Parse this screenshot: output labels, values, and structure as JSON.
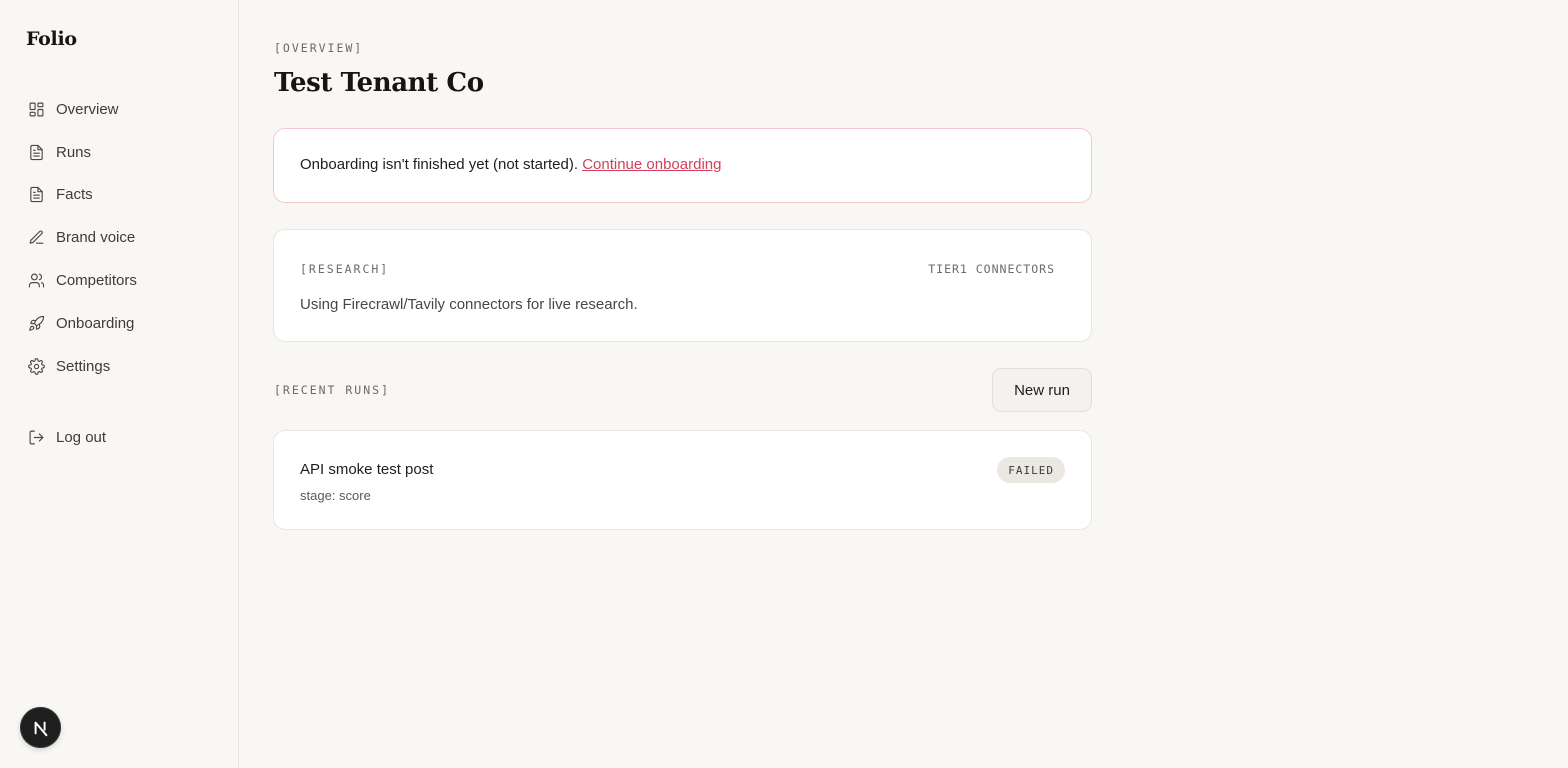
{
  "app": {
    "brand": "Folio"
  },
  "sidebar": {
    "items": [
      {
        "label": "Overview",
        "icon": "grid-icon"
      },
      {
        "label": "Runs",
        "icon": "document-icon"
      },
      {
        "label": "Facts",
        "icon": "document-icon"
      },
      {
        "label": "Brand voice",
        "icon": "pen-icon"
      },
      {
        "label": "Competitors",
        "icon": "users-icon"
      },
      {
        "label": "Onboarding",
        "icon": "rocket-icon"
      },
      {
        "label": "Settings",
        "icon": "gear-icon"
      }
    ],
    "logout_label": "Log out",
    "avatar_letter": "N"
  },
  "page": {
    "eyebrow": "[OVERVIEW]",
    "title": "Test Tenant Co"
  },
  "alert": {
    "text": "Onboarding isn't finished yet (not started). ",
    "link": "Continue onboarding"
  },
  "research": {
    "label": "[RESEARCH]",
    "meta": "TIER1 CONNECTORS",
    "description": "Using Firecrawl/Tavily connectors for live research."
  },
  "recent_runs": {
    "label": "[RECENT RUNS]",
    "new_run_label": "New run",
    "runs": [
      {
        "title": "API smoke test post",
        "stage": "stage: score",
        "status": "FAILED"
      }
    ]
  },
  "colors": {
    "background": "#f8f7f4",
    "accent_link": "#d3405e",
    "alert_border": "#f3c9cf"
  }
}
